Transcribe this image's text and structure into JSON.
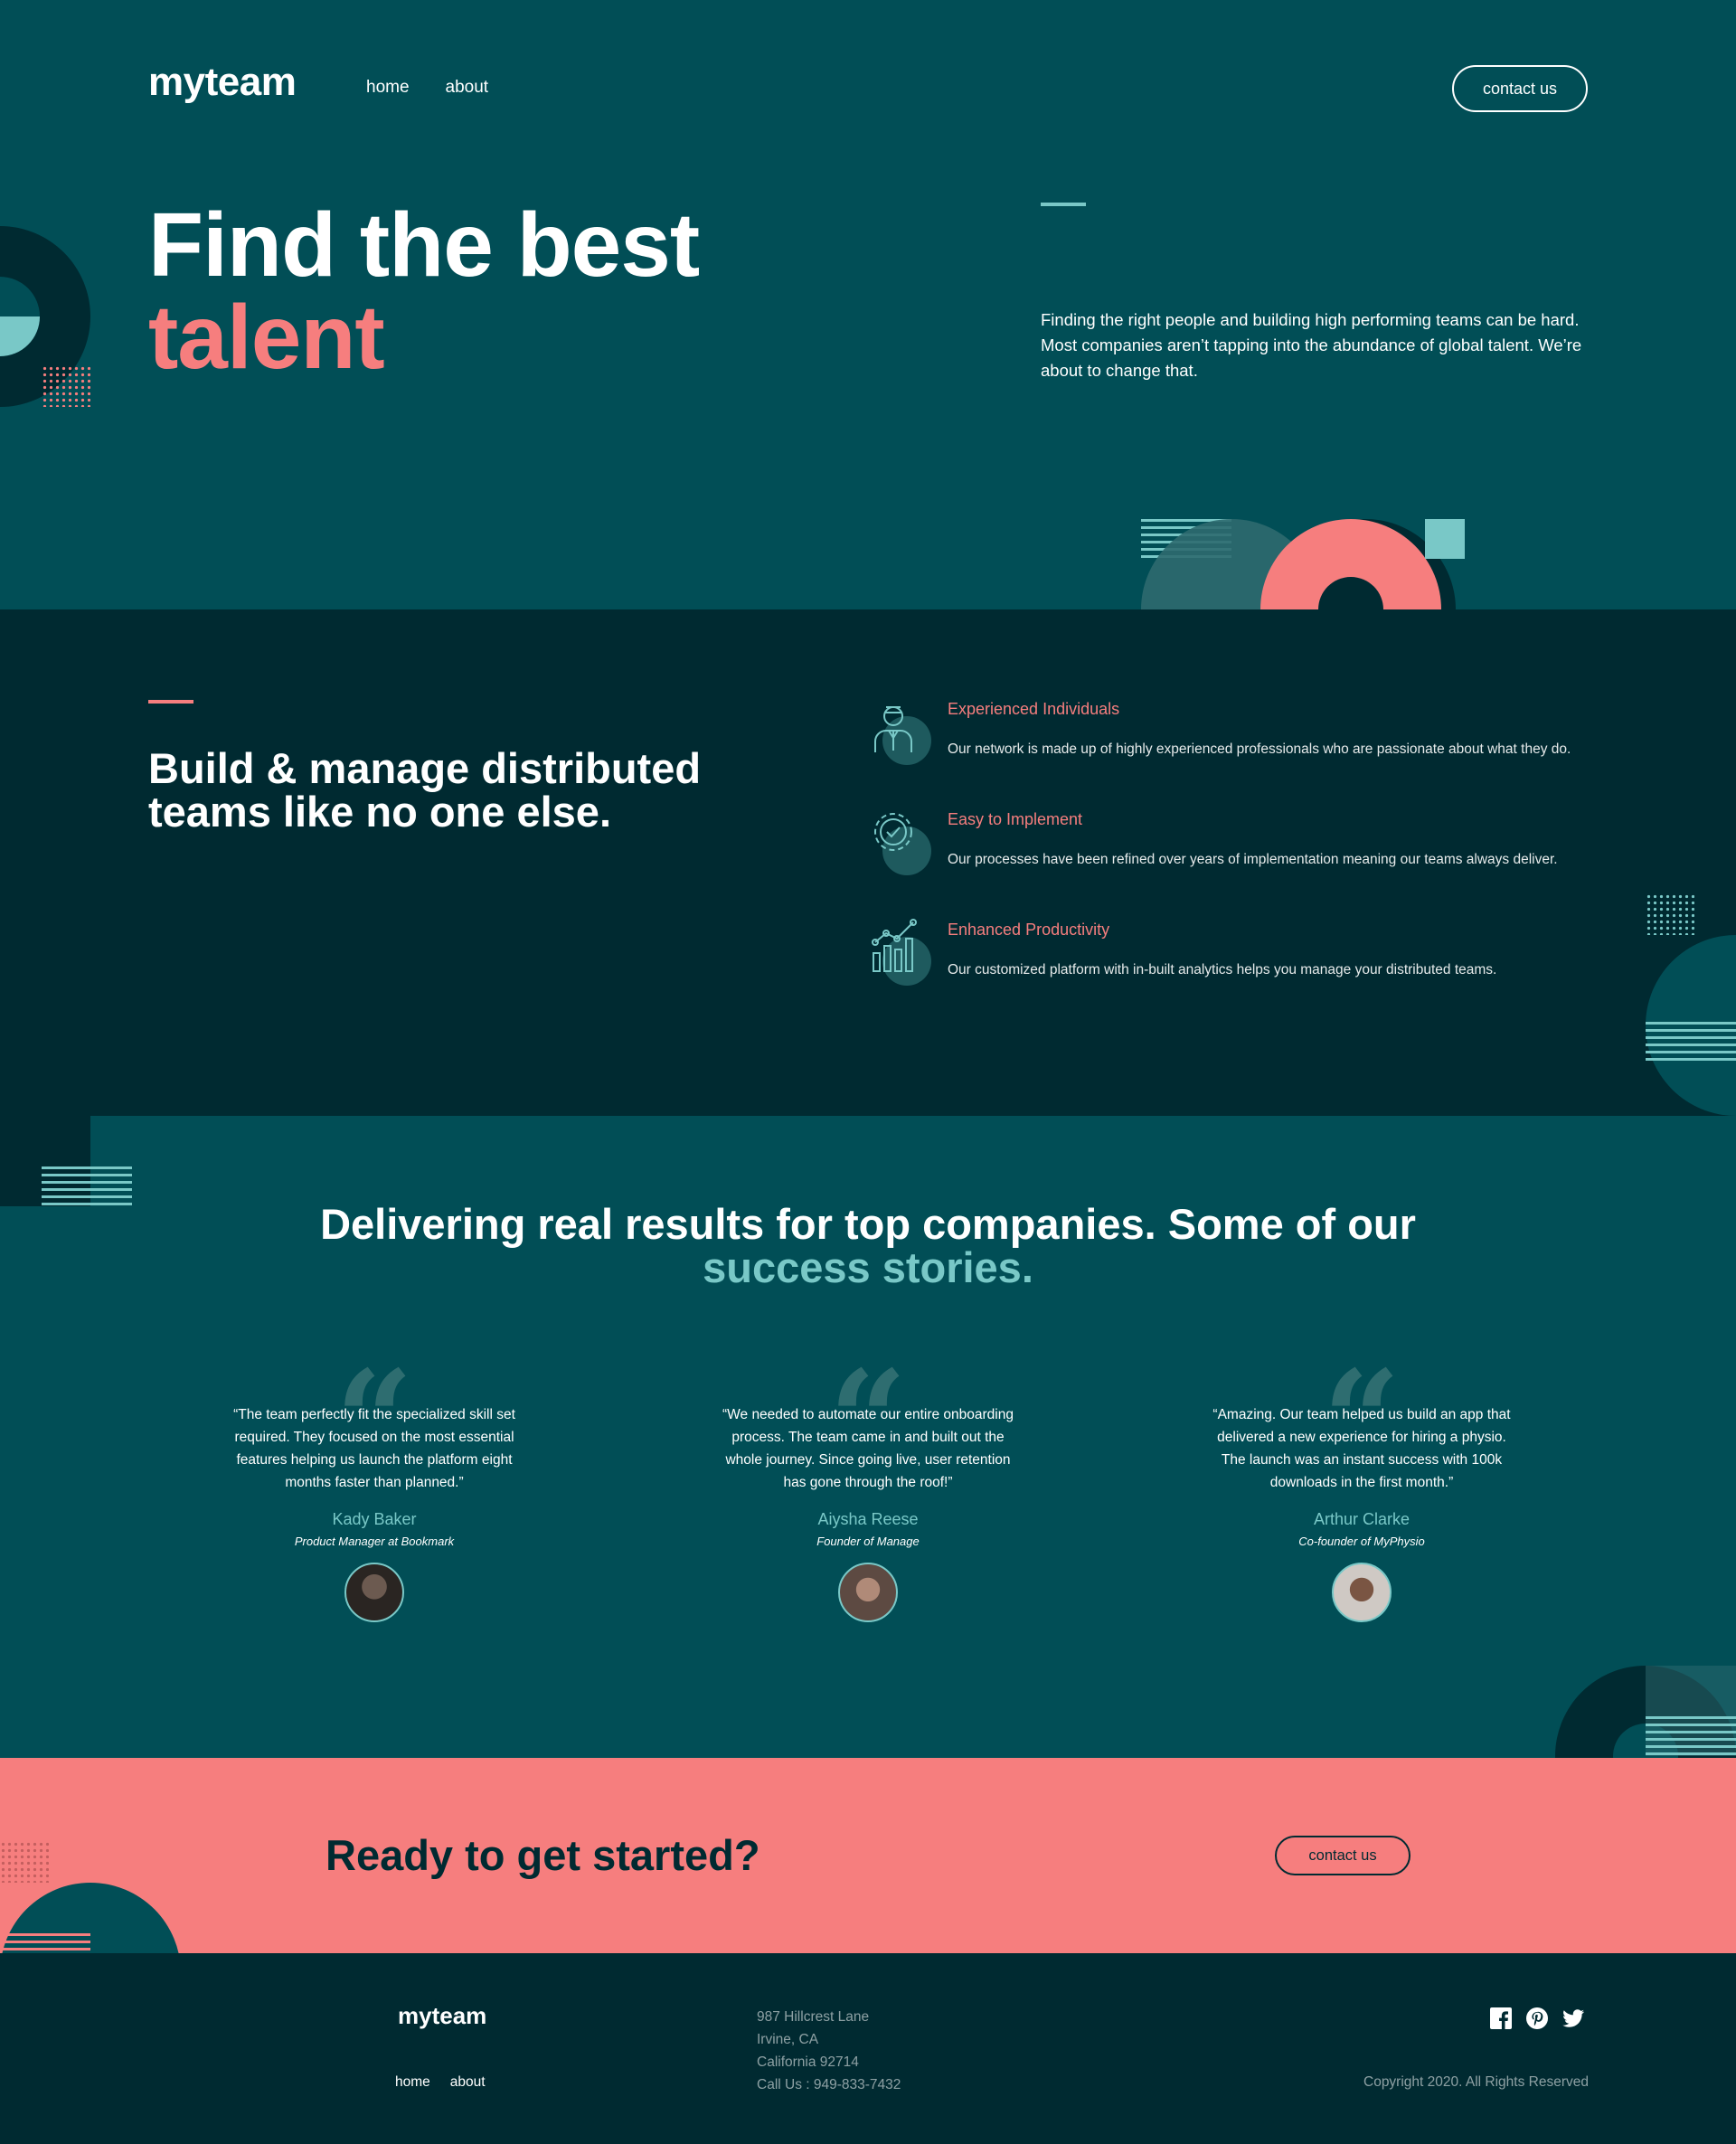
{
  "header": {
    "logo": "myteam",
    "nav": [
      "home",
      "about"
    ],
    "contact_label": "contact us"
  },
  "hero": {
    "title_line1": "Find the best",
    "title_line2": "talent",
    "text": "Finding the right people and building high performing teams can be hard. Most companies aren’t tapping into the abundance of global talent. We’re about to change that."
  },
  "features": {
    "title": "Build & manage distributed teams like no one else.",
    "items": [
      {
        "icon": "person-icon",
        "title": "Experienced Individuals",
        "desc": "Our network is made up of highly experienced professionals who are passionate about what they do."
      },
      {
        "icon": "cog-icon",
        "title": "Easy to Implement",
        "desc": "Our processes have been refined over years of implementation meaning our teams always deliver."
      },
      {
        "icon": "chart-icon",
        "title": "Enhanced Productivity",
        "desc": "Our customized platform with in-built analytics helps you manage your distributed teams."
      }
    ]
  },
  "stories": {
    "title": "Delivering real results for top companies. Some of our",
    "highlight": "success stories.",
    "testimonials": [
      {
        "quote": "“The team perfectly fit the specialized skill set required. They focused on the most essential features helping us launch the platform eight months faster than planned.”",
        "name": "Kady Baker",
        "role": "Product Manager at Bookmark"
      },
      {
        "quote": "“We needed to automate our entire onboarding process. The team came in and built out the whole journey. Since going live, user retention has gone through the roof!”",
        "name": "Aiysha Reese",
        "role": "Founder of Manage"
      },
      {
        "quote": "“Amazing. Our team helped us build an app that delivered a new experience for hiring a physio. The launch was an instant success with 100k downloads in the first month.”",
        "name": "Arthur Clarke",
        "role": "Co-founder of MyPhysio"
      }
    ]
  },
  "cta": {
    "title": "Ready to get started?",
    "button": "contact us"
  },
  "footer": {
    "logo": "myteam",
    "nav": [
      "home",
      "about"
    ],
    "address": [
      "987 Hillcrest Lane",
      "Irvine, CA",
      "California 92714",
      "Call Us : 949-833-7432"
    ],
    "social": [
      "facebook-icon",
      "pinterest-icon",
      "twitter-icon"
    ],
    "copyright": "Copyright 2020. All Rights Reserved"
  },
  "colors": {
    "dark_teal": "#014e56",
    "deep_teal": "#002a31",
    "coral": "#f67e7e",
    "light_teal": "#79c8c7"
  }
}
